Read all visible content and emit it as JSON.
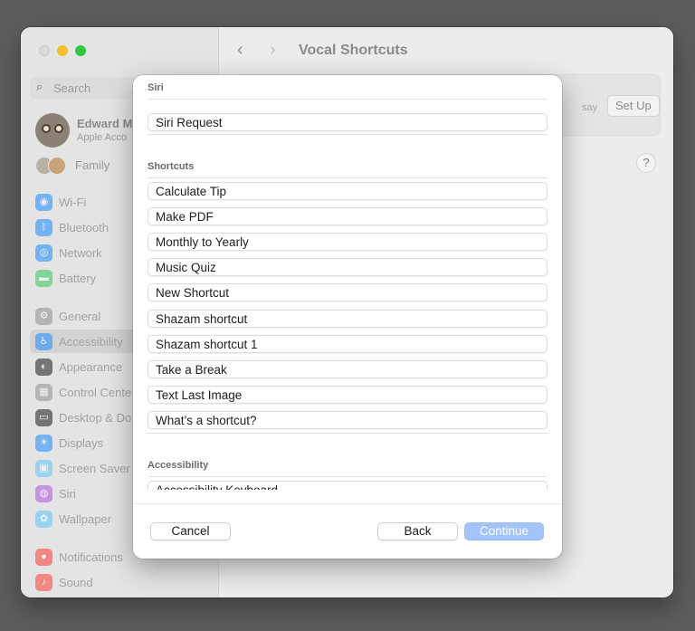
{
  "window": {
    "title": "Vocal Shortcuts"
  },
  "sidebar": {
    "search_placeholder": "Search",
    "account": {
      "name": "Edward M",
      "subtitle": "Apple Acco"
    },
    "family_label": "Family",
    "items": [
      {
        "label": "Wi-Fi",
        "icon": "wifi-icon",
        "color": "#1a8cff"
      },
      {
        "label": "Bluetooth",
        "icon": "bluetooth-icon",
        "color": "#1a8cff"
      },
      {
        "label": "Network",
        "icon": "globe-icon",
        "color": "#1a8cff"
      },
      {
        "label": "Battery",
        "icon": "battery-icon",
        "color": "#34c759"
      },
      {
        "label": "General",
        "icon": "gear-icon",
        "color": "#8e8e93"
      },
      {
        "label": "Accessibility",
        "icon": "accessibility-icon",
        "color": "#1a8cff",
        "active": true
      },
      {
        "label": "Appearance",
        "icon": "appearance-icon",
        "color": "#1c1c1e"
      },
      {
        "label": "Control Cente",
        "icon": "control-center-icon",
        "color": "#8e8e93"
      },
      {
        "label": "Desktop & Do",
        "icon": "desktop-dock-icon",
        "color": "#1c1c1e"
      },
      {
        "label": "Displays",
        "icon": "displays-icon",
        "color": "#1a8cff"
      },
      {
        "label": "Screen Saver",
        "icon": "screen-saver-icon",
        "color": "#5ac8fa"
      },
      {
        "label": "Siri",
        "icon": "siri-icon",
        "color": "#af52de"
      },
      {
        "label": "Wallpaper",
        "icon": "wallpaper-icon",
        "color": "#5ac8fa"
      },
      {
        "label": "Notifications",
        "icon": "notifications-icon",
        "color": "#ff3b30"
      },
      {
        "label": "Sound",
        "icon": "sound-icon",
        "color": "#ff3b30"
      }
    ]
  },
  "main": {
    "say_text": "say",
    "setup_label": "Set Up",
    "help_label": "?"
  },
  "modal": {
    "sections": [
      {
        "header": "Siri",
        "items": [
          "Siri Request"
        ]
      },
      {
        "header": "Shortcuts",
        "items": [
          "Calculate Tip",
          "Make PDF",
          "Monthly to Yearly",
          "Music Quiz",
          "New Shortcut",
          "Shazam shortcut",
          "Shazam shortcut 1",
          "Take a Break",
          "Text Last Image",
          "What’s a shortcut?"
        ]
      },
      {
        "header": "Accessibility",
        "items": [
          "Accessibility Keyboard"
        ]
      }
    ],
    "buttons": {
      "cancel": "Cancel",
      "back": "Back",
      "continue": "Continue"
    }
  },
  "colors": {
    "accent_disabled": "#a2c4fb",
    "traffic_min": "#f5bf2e",
    "traffic_max": "#2fc741"
  }
}
